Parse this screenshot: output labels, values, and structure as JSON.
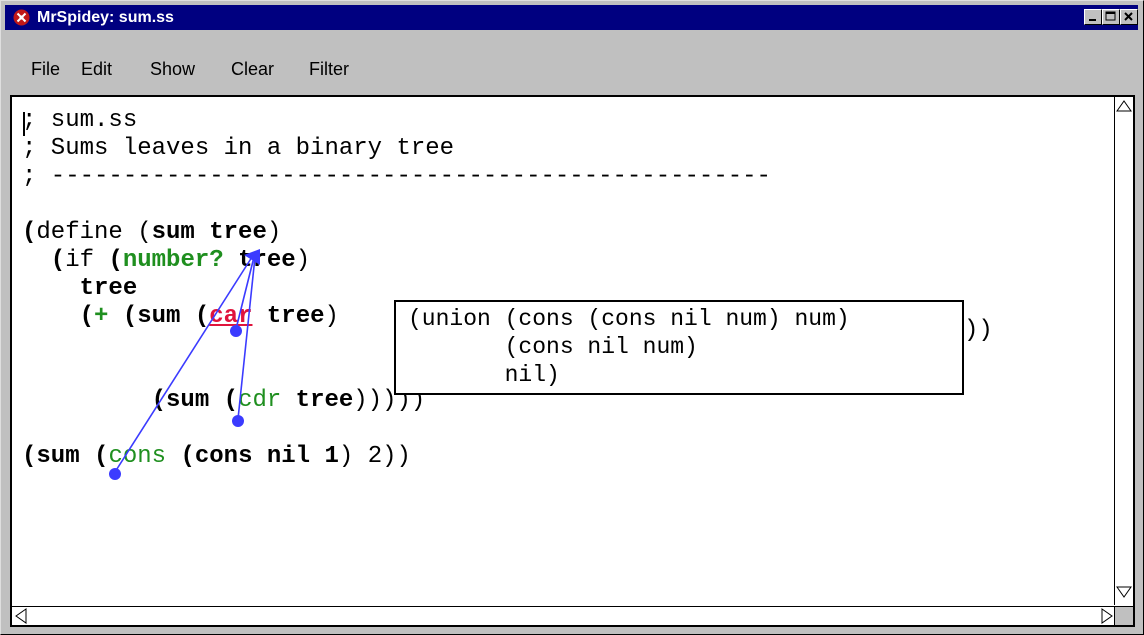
{
  "window": {
    "title": "MrSpidey: sum.ss",
    "title_icon": "mrspidey-icon",
    "titlebar_color": "#000080",
    "controls": [
      "minimize-icon",
      "maximize-icon",
      "close-icon"
    ]
  },
  "menu": {
    "items": [
      "File",
      "Edit",
      "Show",
      "Clear",
      "Filter"
    ]
  },
  "editor": {
    "lines": [
      {
        "segments": [
          {
            "text": "; sum.ss",
            "style": "plain"
          }
        ]
      },
      {
        "segments": [
          {
            "text": "; Sums leaves in a binary tree",
            "style": "plain"
          }
        ]
      },
      {
        "segments": [
          {
            "text": "; --------------------------------------------------",
            "style": "plain"
          }
        ]
      },
      {
        "segments": []
      },
      {
        "segments": [
          {
            "text": "(",
            "style": "bold"
          },
          {
            "text": "define (",
            "style": "plain"
          },
          {
            "text": "sum tree",
            "style": "bold"
          },
          {
            "text": ")",
            "style": "plain"
          }
        ]
      },
      {
        "segments": [
          {
            "text": "  (",
            "style": "bold"
          },
          {
            "text": "if ",
            "style": "plain"
          },
          {
            "text": "(",
            "style": "bold"
          },
          {
            "text": "number?",
            "style": "green"
          },
          {
            "text": " tree",
            "style": "bold"
          },
          {
            "text": ")",
            "style": "plain"
          }
        ]
      },
      {
        "segments": [
          {
            "text": "    tree",
            "style": "bold"
          }
        ]
      },
      {
        "segments": [
          {
            "text": "    (",
            "style": "bold"
          },
          {
            "text": "+",
            "style": "green"
          },
          {
            "text": " (",
            "style": "bold"
          },
          {
            "text": "sum",
            "style": "bold"
          },
          {
            "text": " (",
            "style": "bold"
          },
          {
            "text": "car",
            "style": "red"
          },
          {
            "text": " tree",
            "style": "bold"
          },
          {
            "text": ")",
            "style": "plain"
          }
        ]
      },
      {
        "segments": []
      },
      {
        "segments": []
      },
      {
        "segments": [
          {
            "text": "         (",
            "style": "bold"
          },
          {
            "text": "sum",
            "style": "bold"
          },
          {
            "text": " (",
            "style": "bold"
          },
          {
            "text": "cdr",
            "style": "greenplain"
          },
          {
            "text": " tree",
            "style": "bold"
          },
          {
            "text": ")))))",
            "style": "plain"
          }
        ]
      },
      {
        "segments": []
      },
      {
        "segments": [
          {
            "text": "(",
            "style": "bold"
          },
          {
            "text": "sum",
            "style": "bold"
          },
          {
            "text": " (",
            "style": "bold"
          },
          {
            "text": "cons",
            "style": "greenplain"
          },
          {
            "text": " (",
            "style": "bold"
          },
          {
            "text": "cons nil 1",
            "style": "bold"
          },
          {
            "text": ") 2))",
            "style": "plain"
          }
        ]
      }
    ],
    "trailing_close_after_box": "))",
    "type_box": {
      "lines": [
        "(union (cons (cons nil num) num)",
        "       (cons nil num)",
        "       nil)"
      ]
    },
    "arrow_color": "#3b3bff"
  }
}
